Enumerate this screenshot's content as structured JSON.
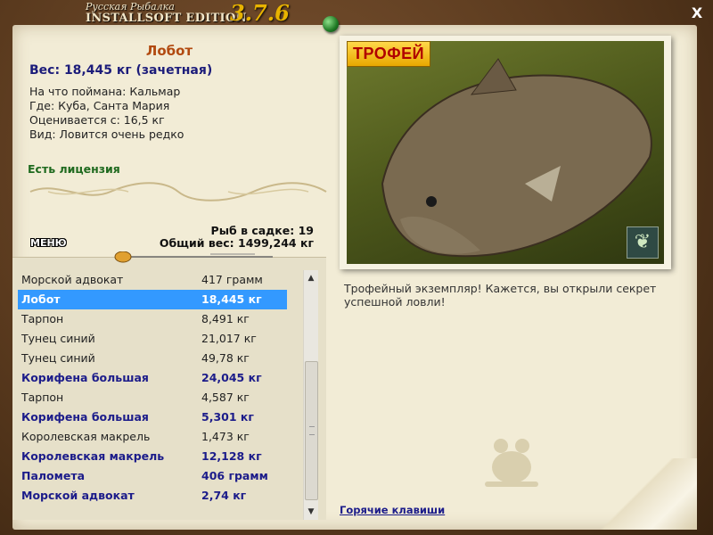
{
  "window": {
    "logo_line1": "Русская Рыбалка",
    "logo_line2": "INSTALLSOFT EDITION",
    "version": "3.7.6",
    "close_label": "X"
  },
  "fish": {
    "name": "Лобот",
    "weight": "Вес: 18,445 кг (зачетная)",
    "bait": "На что поймана: Кальмар",
    "location": "Где: Куба, Санта Мария",
    "rated_from": "Оценивается с: 16,5 кг",
    "rarity": "Вид: Ловится очень редко",
    "license": "Есть лицензия"
  },
  "cage": {
    "count": "Рыб в садке: 19",
    "total": "Общий вес: 1499,244 кг"
  },
  "menu_label": "МЕНЮ",
  "photo": {
    "badge": "ТРОФЕЙ",
    "butterfly_icon": "butterfly-icon"
  },
  "trophy_text": "Трофейный экземпляр! Кажется, вы открыли секрет успешной ловли!",
  "hotkeys": "Горячие клавиши",
  "catch_list": [
    {
      "name": "Морской адвокат",
      "weight": "417 грамм",
      "style": "norm"
    },
    {
      "name": "Лобот",
      "weight": "18,445 кг",
      "style": "sel"
    },
    {
      "name": "Тарпон",
      "weight": "8,491 кг",
      "style": "norm"
    },
    {
      "name": "Тунец синий",
      "weight": "21,017 кг",
      "style": "norm"
    },
    {
      "name": "Тунец синий",
      "weight": "49,78 кг",
      "style": "norm"
    },
    {
      "name": "Корифена большая",
      "weight": "24,045 кг",
      "style": "bold"
    },
    {
      "name": "Тарпон",
      "weight": "4,587 кг",
      "style": "norm"
    },
    {
      "name": "Корифена большая",
      "weight": "5,301 кг",
      "style": "bold"
    },
    {
      "name": "Королевская макрель",
      "weight": "1,473 кг",
      "style": "norm"
    },
    {
      "name": "Королевская макрель",
      "weight": "12,128 кг",
      "style": "bold"
    },
    {
      "name": "Паломета",
      "weight": "406 грамм",
      "style": "bold"
    },
    {
      "name": "Морской адвокат",
      "weight": "2,74 кг",
      "style": "bold"
    }
  ],
  "colors": {
    "selection": "#3399ff",
    "bold_row": "#1c1c8a",
    "fish_name": "#b24a10",
    "license": "#1f6a1f"
  }
}
